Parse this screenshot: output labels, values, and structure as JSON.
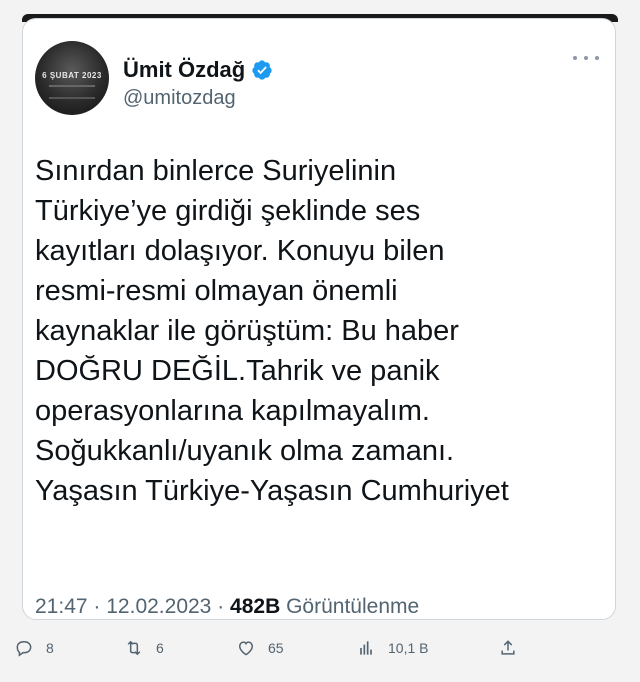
{
  "tweet": {
    "author": {
      "display_name": "Ümit Özdağ",
      "handle": "@umitozdag",
      "avatar_text": "6 ŞUBAT 2023",
      "verified_icon": "verified-badge-icon",
      "verified_color": "#1d9bf0"
    },
    "text": "Sınırdan binlerce Suriyelinin\nTürkiye’ye girdiği şeklinde ses\nkayıtları dolaşıyor. Konuyu bilen\nresmi-resmi olmayan önemli\nkaynaklar ile görüştüm: Bu haber\nDOĞRU DEĞİL.Tahrik ve panik\noperasyonlarına kapılmayalım.\nSoğukkanlı/uyanık olma zamanı.\nYaşasın Türkiye-Yaşasın Cumhuriyet",
    "time": "21:47",
    "separator": "·",
    "date": "12.02.2023",
    "views_count": "482B",
    "views_label": "Görüntülenme"
  },
  "actions": {
    "reply_count": "8",
    "retweet_count": "6",
    "like_count": "65",
    "analytics_count": "10,1 B"
  },
  "colors": {
    "text": "#0f1419",
    "secondary": "#536471",
    "background": "#f3f3f3",
    "card": "#ffffff"
  }
}
